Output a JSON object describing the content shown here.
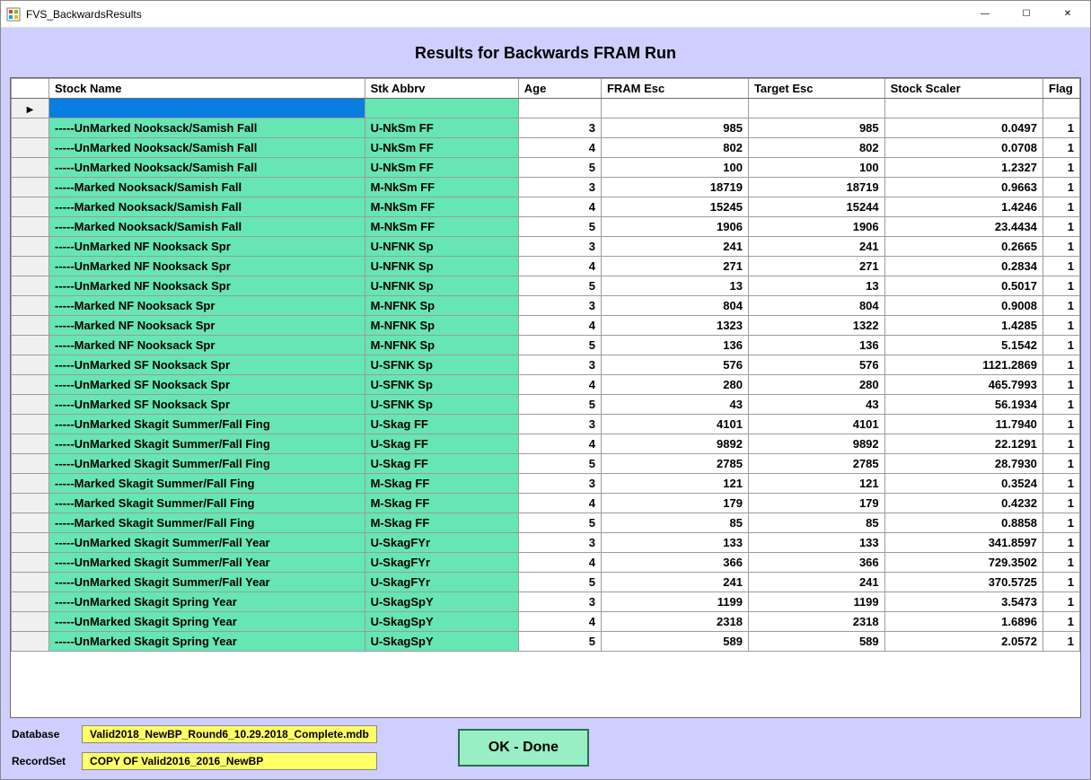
{
  "window": {
    "title": "FVS_BackwardsResults"
  },
  "page": {
    "heading": "Results for Backwards FRAM Run"
  },
  "grid": {
    "columns": [
      "Stock Name",
      "Stk Abbrv",
      "Age",
      "FRAM Esc",
      "Target Esc",
      "Stock Scaler",
      "Flag"
    ],
    "rows": [
      {
        "stock": "",
        "abbrv": "",
        "age": "",
        "fram": "",
        "target": "",
        "scaler": "",
        "flag": "",
        "selected": true
      },
      {
        "stock": "-----UnMarked Nooksack/Samish Fall",
        "abbrv": "U-NkSm FF",
        "age": "3",
        "fram": "985",
        "target": "985",
        "scaler": "0.0497",
        "flag": "1"
      },
      {
        "stock": "-----UnMarked Nooksack/Samish Fall",
        "abbrv": "U-NkSm FF",
        "age": "4",
        "fram": "802",
        "target": "802",
        "scaler": "0.0708",
        "flag": "1"
      },
      {
        "stock": "-----UnMarked Nooksack/Samish Fall",
        "abbrv": "U-NkSm FF",
        "age": "5",
        "fram": "100",
        "target": "100",
        "scaler": "1.2327",
        "flag": "1"
      },
      {
        "stock": "-----Marked Nooksack/Samish Fall",
        "abbrv": "M-NkSm FF",
        "age": "3",
        "fram": "18719",
        "target": "18719",
        "scaler": "0.9663",
        "flag": "1"
      },
      {
        "stock": "-----Marked Nooksack/Samish Fall",
        "abbrv": "M-NkSm FF",
        "age": "4",
        "fram": "15245",
        "target": "15244",
        "scaler": "1.4246",
        "flag": "1"
      },
      {
        "stock": "-----Marked Nooksack/Samish Fall",
        "abbrv": "M-NkSm FF",
        "age": "5",
        "fram": "1906",
        "target": "1906",
        "scaler": "23.4434",
        "flag": "1"
      },
      {
        "stock": "-----UnMarked NF Nooksack Spr",
        "abbrv": "U-NFNK Sp",
        "age": "3",
        "fram": "241",
        "target": "241",
        "scaler": "0.2665",
        "flag": "1"
      },
      {
        "stock": "-----UnMarked NF Nooksack Spr",
        "abbrv": "U-NFNK Sp",
        "age": "4",
        "fram": "271",
        "target": "271",
        "scaler": "0.2834",
        "flag": "1"
      },
      {
        "stock": "-----UnMarked NF Nooksack Spr",
        "abbrv": "U-NFNK Sp",
        "age": "5",
        "fram": "13",
        "target": "13",
        "scaler": "0.5017",
        "flag": "1"
      },
      {
        "stock": "-----Marked NF Nooksack Spr",
        "abbrv": "M-NFNK Sp",
        "age": "3",
        "fram": "804",
        "target": "804",
        "scaler": "0.9008",
        "flag": "1"
      },
      {
        "stock": "-----Marked NF Nooksack Spr",
        "abbrv": "M-NFNK Sp",
        "age": "4",
        "fram": "1323",
        "target": "1322",
        "scaler": "1.4285",
        "flag": "1"
      },
      {
        "stock": "-----Marked NF Nooksack Spr",
        "abbrv": "M-NFNK Sp",
        "age": "5",
        "fram": "136",
        "target": "136",
        "scaler": "5.1542",
        "flag": "1"
      },
      {
        "stock": "-----UnMarked SF Nooksack Spr",
        "abbrv": "U-SFNK Sp",
        "age": "3",
        "fram": "576",
        "target": "576",
        "scaler": "1121.2869",
        "flag": "1"
      },
      {
        "stock": "-----UnMarked SF Nooksack Spr",
        "abbrv": "U-SFNK Sp",
        "age": "4",
        "fram": "280",
        "target": "280",
        "scaler": "465.7993",
        "flag": "1"
      },
      {
        "stock": "-----UnMarked SF Nooksack Spr",
        "abbrv": "U-SFNK Sp",
        "age": "5",
        "fram": "43",
        "target": "43",
        "scaler": "56.1934",
        "flag": "1"
      },
      {
        "stock": "-----UnMarked Skagit Summer/Fall Fing",
        "abbrv": "U-Skag FF",
        "age": "3",
        "fram": "4101",
        "target": "4101",
        "scaler": "11.7940",
        "flag": "1"
      },
      {
        "stock": "-----UnMarked Skagit Summer/Fall Fing",
        "abbrv": "U-Skag FF",
        "age": "4",
        "fram": "9892",
        "target": "9892",
        "scaler": "22.1291",
        "flag": "1"
      },
      {
        "stock": "-----UnMarked Skagit Summer/Fall Fing",
        "abbrv": "U-Skag FF",
        "age": "5",
        "fram": "2785",
        "target": "2785",
        "scaler": "28.7930",
        "flag": "1"
      },
      {
        "stock": "-----Marked Skagit Summer/Fall Fing",
        "abbrv": "M-Skag FF",
        "age": "3",
        "fram": "121",
        "target": "121",
        "scaler": "0.3524",
        "flag": "1"
      },
      {
        "stock": "-----Marked Skagit Summer/Fall Fing",
        "abbrv": "M-Skag FF",
        "age": "4",
        "fram": "179",
        "target": "179",
        "scaler": "0.4232",
        "flag": "1"
      },
      {
        "stock": "-----Marked Skagit Summer/Fall Fing",
        "abbrv": "M-Skag FF",
        "age": "5",
        "fram": "85",
        "target": "85",
        "scaler": "0.8858",
        "flag": "1"
      },
      {
        "stock": "-----UnMarked Skagit Summer/Fall Year",
        "abbrv": "U-SkagFYr",
        "age": "3",
        "fram": "133",
        "target": "133",
        "scaler": "341.8597",
        "flag": "1"
      },
      {
        "stock": "-----UnMarked Skagit Summer/Fall Year",
        "abbrv": "U-SkagFYr",
        "age": "4",
        "fram": "366",
        "target": "366",
        "scaler": "729.3502",
        "flag": "1"
      },
      {
        "stock": "-----UnMarked Skagit Summer/Fall Year",
        "abbrv": "U-SkagFYr",
        "age": "5",
        "fram": "241",
        "target": "241",
        "scaler": "370.5725",
        "flag": "1"
      },
      {
        "stock": "-----UnMarked Skagit Spring Year",
        "abbrv": "U-SkagSpY",
        "age": "3",
        "fram": "1199",
        "target": "1199",
        "scaler": "3.5473",
        "flag": "1"
      },
      {
        "stock": "-----UnMarked Skagit Spring Year",
        "abbrv": "U-SkagSpY",
        "age": "4",
        "fram": "2318",
        "target": "2318",
        "scaler": "1.6896",
        "flag": "1"
      },
      {
        "stock": "-----UnMarked Skagit Spring Year",
        "abbrv": "U-SkagSpY",
        "age": "5",
        "fram": "589",
        "target": "589",
        "scaler": "2.0572",
        "flag": "1"
      }
    ]
  },
  "footer": {
    "database_label": "Database",
    "database_value": "Valid2018_NewBP_Round6_10.29.2018_Complete.mdb",
    "recordset_label": "RecordSet",
    "recordset_value": "COPY OF Valid2016_2016_NewBP",
    "ok_label": "OK - Done"
  }
}
